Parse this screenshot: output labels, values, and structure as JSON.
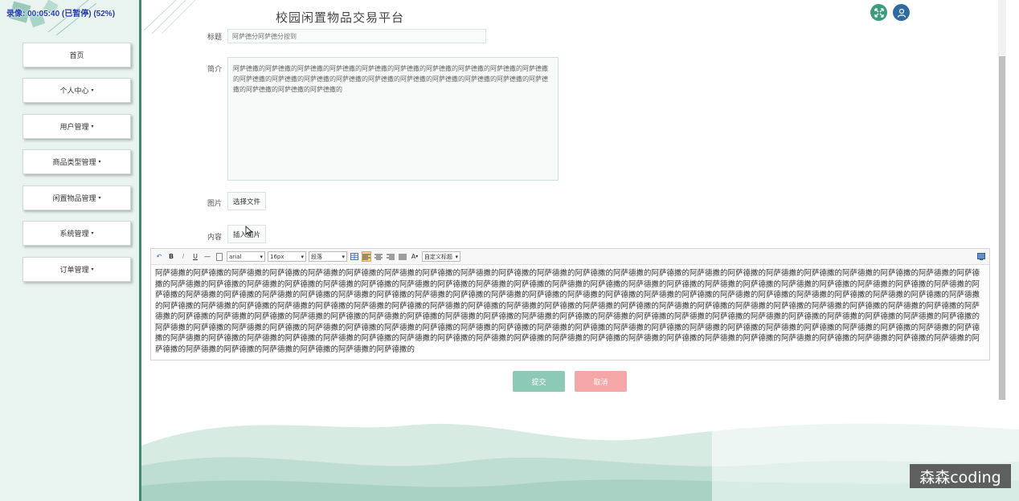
{
  "recording": {
    "label": "录像: 00:05:40 (已暂停) (52%)"
  },
  "header": {
    "title": "校园闲置物品交易平台",
    "icons": [
      "expand-icon",
      "user-icon"
    ]
  },
  "sidebar": {
    "items": [
      {
        "label": "首页",
        "has_caret": false
      },
      {
        "label": "个人中心",
        "has_caret": true
      },
      {
        "label": "用户管理",
        "has_caret": true
      },
      {
        "label": "商品类型管理",
        "has_caret": true
      },
      {
        "label": "闲置物品管理",
        "has_caret": true
      },
      {
        "label": "系统管理",
        "has_caret": true
      },
      {
        "label": "订单管理",
        "has_caret": true
      }
    ],
    "caret": "▾"
  },
  "form": {
    "title_label": "标题",
    "title_value": "阿萨德分阿萨德分按到",
    "intro_label": "简介",
    "intro_value": "阿萨德撒的阿萨德撒的阿萨德撒的阿萨德撒的阿萨德撒的阿萨德撒的阿萨德撒的阿萨德撒的阿萨德撒的阿萨德撒的阿萨德撒的阿萨德撒的阿萨德撒的阿萨德撒的阿萨德撒的阿萨德撒的阿萨德撒的阿萨德撒的阿萨德撒的阿萨德撒的阿萨德撒的阿萨德撒的阿萨德撒的",
    "image_label": "图片",
    "choose_file": "选择文件",
    "content_label": "内容",
    "insert_image": "插入图片"
  },
  "editor": {
    "toolbar": {
      "undo": "↶",
      "bold": "B",
      "italic": "I",
      "underline": "U",
      "hr": "—",
      "font_family": "arial",
      "font_size": "16px",
      "paragraph": "段落",
      "font_color": "A",
      "custom_title": "自定义标题"
    },
    "content": "阿萨德撒的阿萨德撒的阿萨德撒的阿萨德撒的阿萨德撒的阿萨德撒的阿萨德撒的阿萨德撒的阿萨德撒的阿萨德撒的阿萨德撒的阿萨德撒的阿萨德撒的阿萨德撒的阿萨德撒的阿萨德撒的阿萨德撒的阿萨德撒的阿萨德撒的阿萨德撒的阿萨德撒的阿萨德撒的阿萨德撒的阿萨德撒的阿萨德撒的阿萨德撒的阿萨德撒的阿萨德撒的阿萨德撒的阿萨德撒的阿萨德撒的阿萨德撒的阿萨德撒的阿萨德撒的阿萨德撒的阿萨德撒的阿萨德撒的阿萨德撒的阿萨德撒的阿萨德撒的阿萨德撒的阿萨德撒的阿萨德撒的阿萨德撒的阿萨德撒的阿萨德撒的阿萨德撒的阿萨德撒的阿萨德撒的阿萨德撒的阿萨德撒的阿萨德撒的阿萨德撒的阿萨德撒的阿萨德撒的阿萨德撒的阿萨德撒的阿萨德撒的阿萨德撒的阿萨德撒的阿萨德撒的阿萨德撒的阿萨德撒的阿萨德撒的阿萨德撒的阿萨德撒的阿萨德撒的阿萨德撒的阿萨德撒的阿萨德撒的阿萨德撒的阿萨德撒的阿萨德撒的阿萨德撒的阿萨德撒的阿萨德撒的阿萨德撒的阿萨德撒的阿萨德撒的阿萨德撒的阿萨德撒的阿萨德撒的阿萨德撒的阿萨德撒的阿萨德撒的阿萨德撒的阿萨德撒的阿萨德撒的阿萨德撒的阿萨德撒的阿萨德撒的阿萨德撒的阿萨德撒的阿萨德撒的阿萨德撒的阿萨德撒的阿萨德撒的阿萨德撒的阿萨德撒的阿萨德撒的阿萨德撒的阿萨德撒的阿萨德撒的阿萨德撒的阿萨德撒的阿萨德撒的阿萨德撒的阿萨德撒的阿萨德撒的阿萨德撒的阿萨德撒的阿萨德撒的阿萨德撒的阿萨德撒的阿萨德撒的阿萨德撒的阿萨德撒的阿萨德撒的阿萨德撒的阿萨德撒的阿萨德撒的阿萨德撒的阿萨德撒的阿萨德撒的阿萨德撒的阿萨德撒的阿萨德撒的阿萨德撒的阿萨德撒的阿萨德撒的阿萨德撒的阿萨德撒的阿萨德撒的阿萨德撒的阿萨德撒的阿萨德撒的阿萨德撒的阿萨德撒的阿萨德撒的阿萨德撒的阿萨德撒的阿萨德撒的阿萨德撒的阿萨德撒的阿萨德撒的阿萨德撒的阿萨德撒的阿萨德撒的阿萨德撒的阿萨德撒的阿萨德撒的阿萨德撒的阿萨德撒的阿萨德撒的阿萨德撒的阿萨德撒的阿萨德撒的阿萨德撒的"
  },
  "actions": {
    "submit": "提交",
    "cancel": "取消"
  },
  "watermark": "森森coding",
  "colors": {
    "accent": "#3d8a72",
    "submit": "#8dc9b7",
    "cancel": "#f5a6a6",
    "user_icon": "#2f6aa3"
  }
}
